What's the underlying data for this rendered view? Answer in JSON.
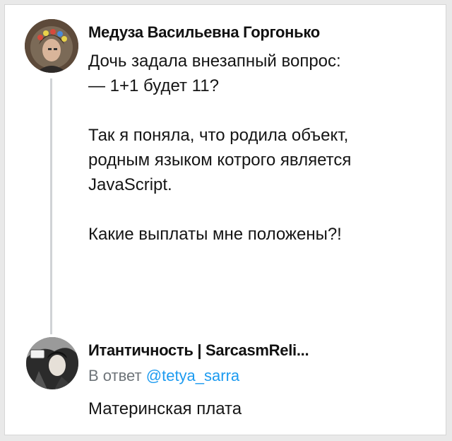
{
  "thread": {
    "post": {
      "author_name": "Медуза Васильевна Горгонько",
      "text": "Дочь задала внезапный вопрос:\n— 1+1 будет 11?\n\nТак я поняла, что родила объект,\nродным языком котрого является\nJavaScript.\n\nКакие выплаты мне положены?!"
    },
    "reply": {
      "author_name": "Итантичность | SarcasmReli...",
      "reply_prefix": "В ответ",
      "mention": "@tetya_sarra",
      "text": "Материнская плата"
    }
  },
  "colors": {
    "mention": "#1d9bf0",
    "secondary_text": "#6e7479",
    "thread_line": "#d0d3d6"
  },
  "icons": {
    "post_avatar": "user-avatar-photo",
    "reply_avatar": "user-avatar-illustration"
  }
}
